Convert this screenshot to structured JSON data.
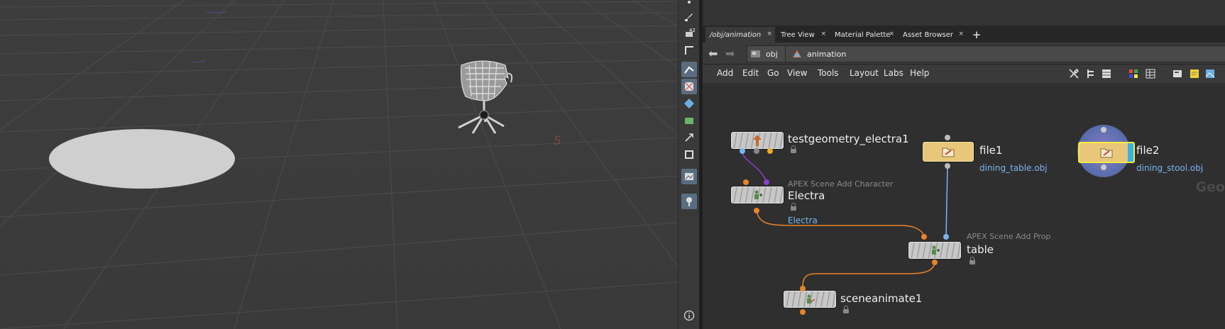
{
  "viewport": {
    "grid_label": "5",
    "objects": [
      "ground-disc",
      "office-chair"
    ]
  },
  "viewport_toolbar": {
    "tools": [
      "select-icon",
      "brush-icon",
      "transform-icon",
      "corner-icon",
      "pose-icon",
      "snap-icon",
      "geo-icon",
      "camera-icon",
      "handle-icon",
      "display-icon",
      "light-icon",
      "pin-icon",
      "info-icon"
    ]
  },
  "tabs": [
    {
      "label": "/obj/animation",
      "active": true
    },
    {
      "label": "Tree View",
      "active": false
    },
    {
      "label": "Material Palette",
      "active": false
    },
    {
      "label": "Asset Browser",
      "active": false
    }
  ],
  "path": {
    "root": "obj",
    "current": "animation"
  },
  "menu": [
    "Add",
    "Edit",
    "Go",
    "View",
    "Tools",
    "Layout",
    "Labs",
    "Help"
  ],
  "network_context": "Geo",
  "nodes": {
    "testgeometry": {
      "name": "testgeometry_electra1"
    },
    "electra": {
      "name": "Electra",
      "type": "APEX Scene Add Character",
      "sub": "Electra"
    },
    "file1": {
      "name": "file1",
      "sub": "dining_table.obj"
    },
    "file2": {
      "name": "file2",
      "sub": "dining_stool.obj"
    },
    "table": {
      "name": "table",
      "type": "APEX Scene Add Prop"
    },
    "sceneanimate": {
      "name": "sceneanimate1"
    }
  },
  "colors": {
    "wire_orange": "#e8842a",
    "wire_blue": "#7ab4f0",
    "wire_purple": "#8a3fd1",
    "file_node": "#e8c77a",
    "selected_ring": "#5e6fae"
  }
}
